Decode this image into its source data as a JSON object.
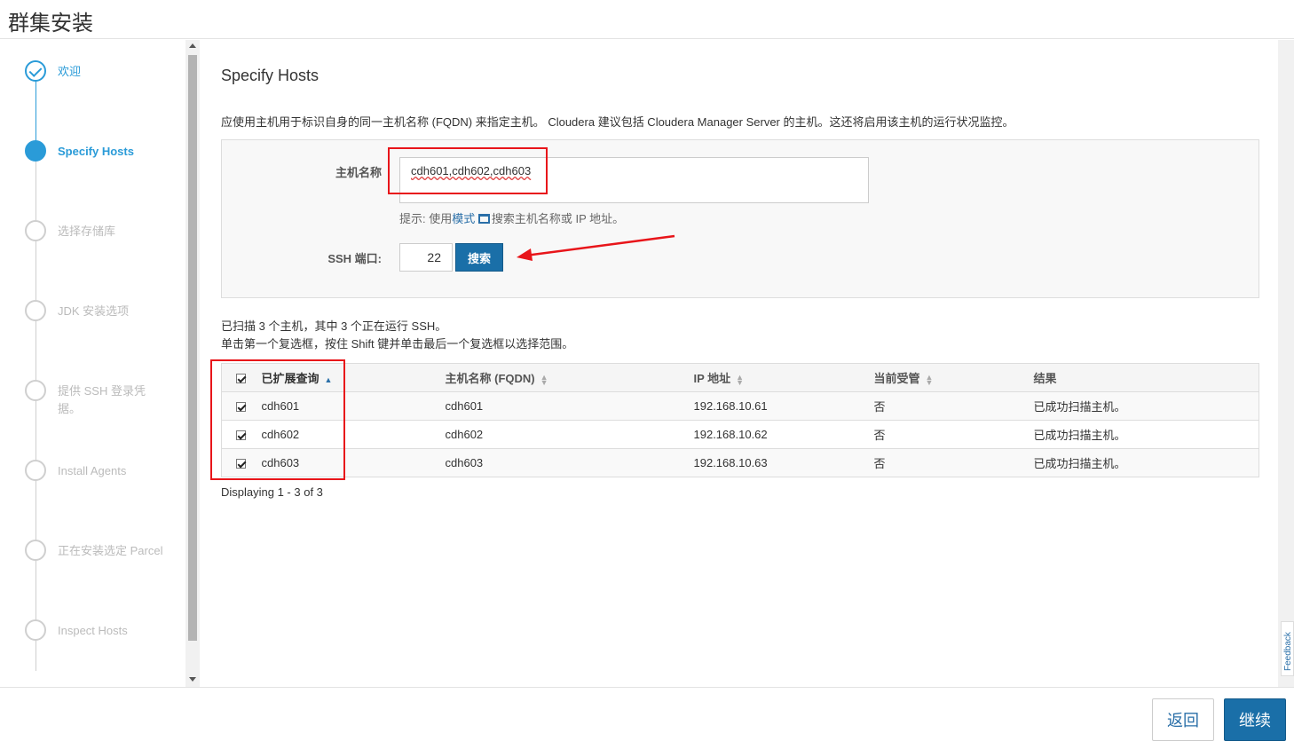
{
  "window": {
    "title": "群集安装"
  },
  "steps": [
    {
      "label": "欢迎",
      "state": "done"
    },
    {
      "label": "Specify Hosts",
      "state": "active"
    },
    {
      "label": "选择存储库",
      "state": "pending"
    },
    {
      "label": "JDK 安装选项",
      "state": "pending"
    },
    {
      "label": "提供 SSH 登录凭据。",
      "state": "pending"
    },
    {
      "label": "Install Agents",
      "state": "pending"
    },
    {
      "label": "正在安装选定 Parcel",
      "state": "pending"
    },
    {
      "label": "Inspect Hosts",
      "state": "pending"
    }
  ],
  "main": {
    "title": "Specify Hosts",
    "description": "应使用主机用于标识自身的同一主机名称 (FQDN) 来指定主机。 Cloudera 建议包括 Cloudera Manager Server 的主机。这还将启用该主机的运行状况监控。"
  },
  "form": {
    "hostname_label": "主机名称",
    "hostname_value": "cdh601,cdh602,cdh603",
    "hint_prefix": "提示: 使用",
    "hint_link": "模式",
    "hint_suffix": "搜索主机名称或 IP 地址。",
    "ssh_label": "SSH 端口:",
    "ssh_port": "22",
    "search_button": "搜索"
  },
  "scan": {
    "line1": "已扫描 3 个主机，其中 3 个正在运行 SSH。",
    "line2": "单击第一个复选框，按住 Shift 键并单击最后一个复选框以选择范围。"
  },
  "table": {
    "headers": [
      "已扩展查询",
      "主机名称 (FQDN)",
      "IP 地址",
      "当前受管",
      "结果"
    ],
    "rows": [
      {
        "query": "cdh601",
        "fqdn": "cdh601",
        "ip": "192.168.10.61",
        "managed": "否",
        "result": "已成功扫描主机。"
      },
      {
        "query": "cdh602",
        "fqdn": "cdh602",
        "ip": "192.168.10.62",
        "managed": "否",
        "result": "已成功扫描主机。"
      },
      {
        "query": "cdh603",
        "fqdn": "cdh603",
        "ip": "192.168.10.63",
        "managed": "否",
        "result": "已成功扫描主机。"
      }
    ],
    "footer": "Displaying 1 - 3 of 3"
  },
  "feedback": "Feedback",
  "footer": {
    "back_label": "返回",
    "continue_label": "继续"
  },
  "colors": {
    "accent": "#2a9bd8",
    "primary_button": "#1a6fa8",
    "annotation_red": "#e8151a"
  }
}
